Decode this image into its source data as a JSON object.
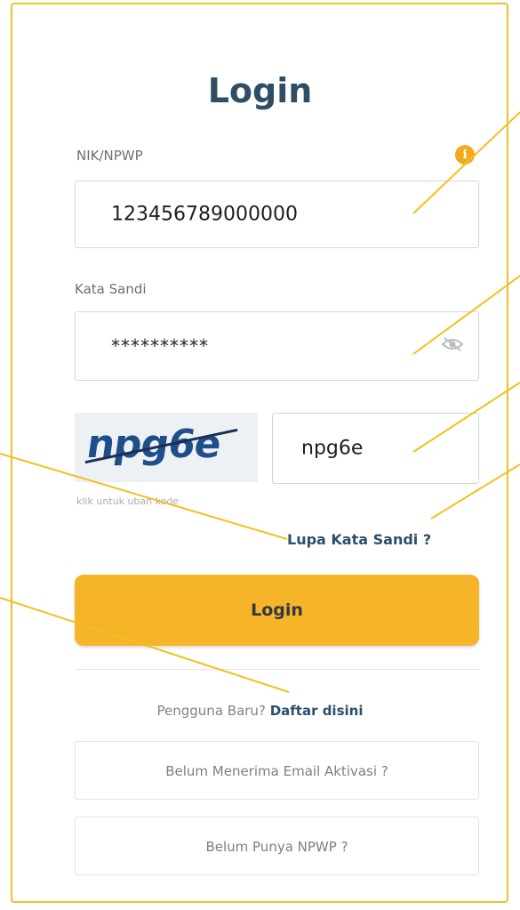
{
  "title": "Login",
  "nik": {
    "label": "NIK/NPWP",
    "value": "123456789000000",
    "info_icon": "i"
  },
  "password": {
    "label": "Kata Sandi",
    "value": "**********"
  },
  "captcha": {
    "image_text": "npg6e",
    "hint": "klik untuk ubah kode",
    "value": "npg6e"
  },
  "forgot_password": "Lupa Kata Sandi ?",
  "login_button": "Login",
  "register": {
    "prompt": "Pengguna Baru?",
    "link": "Daftar disini"
  },
  "buttons": {
    "activation_email": "Belum Menerima Email Aktivasi ?",
    "no_npwp": "Belum Punya NPWP ?"
  },
  "colors": {
    "accent": "#f6b429",
    "border": "#f3bd2e",
    "title": "#2f4e63"
  }
}
